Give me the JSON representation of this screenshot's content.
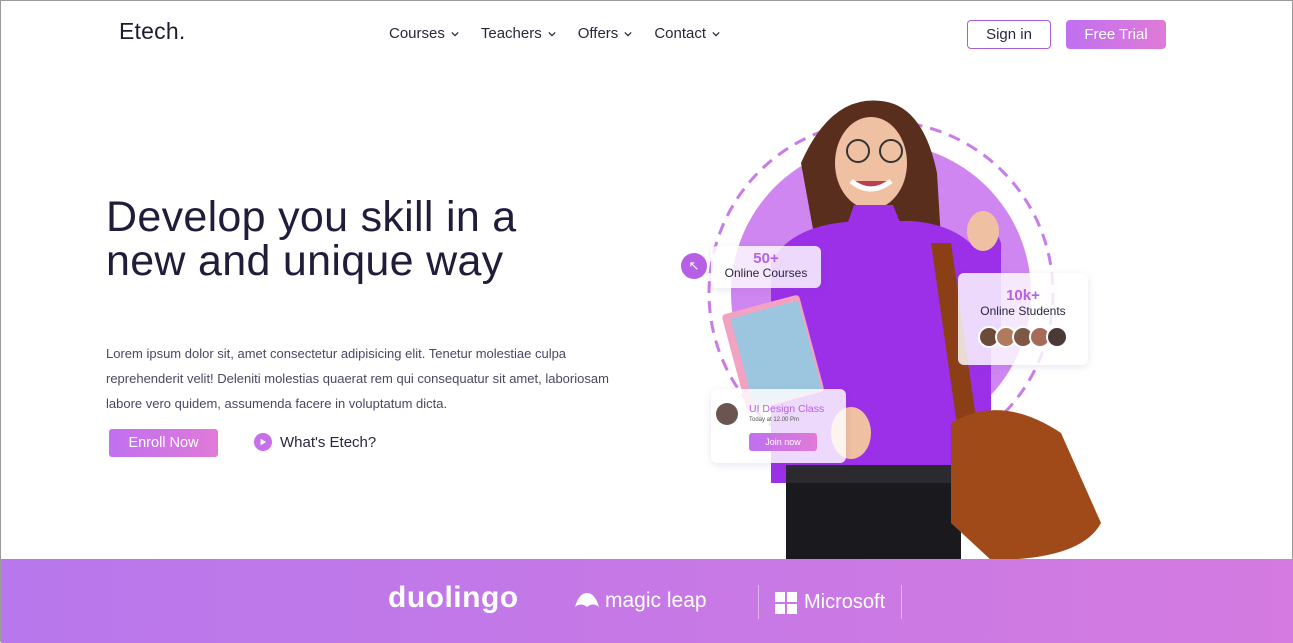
{
  "brand": {
    "logo": "Etech."
  },
  "nav": {
    "items": [
      {
        "label": "Courses"
      },
      {
        "label": "Teachers"
      },
      {
        "label": "Offers"
      },
      {
        "label": "Contact"
      }
    ],
    "signin": "Sign in",
    "trial": "Free Trial"
  },
  "hero": {
    "title": "Develop you skill in a new and unique way",
    "description": "Lorem ipsum dolor sit, amet consectetur adipisicing elit. Tenetur molestiae culpa reprehenderit velit! Deleniti molestias quaerat rem qui consequatur sit amet, laboriosam labore vero quidem, assumenda facere in voluptatum dicta.",
    "enroll": "Enroll Now",
    "whats": "What's Etech?"
  },
  "stats": {
    "courses_value": "50+",
    "courses_label": "Online Courses",
    "students_value": "10k+",
    "students_label": "Online Students",
    "class_title": "UI Design Class",
    "class_time": "Today at 12.00 Pm",
    "class_join": "Join now"
  },
  "partners": {
    "items": [
      "duolingo",
      "magic leap",
      "Microsoft"
    ]
  },
  "colors": {
    "accent": "#c070f0",
    "accent2": "#e07ad8",
    "text": "#211c3a"
  }
}
